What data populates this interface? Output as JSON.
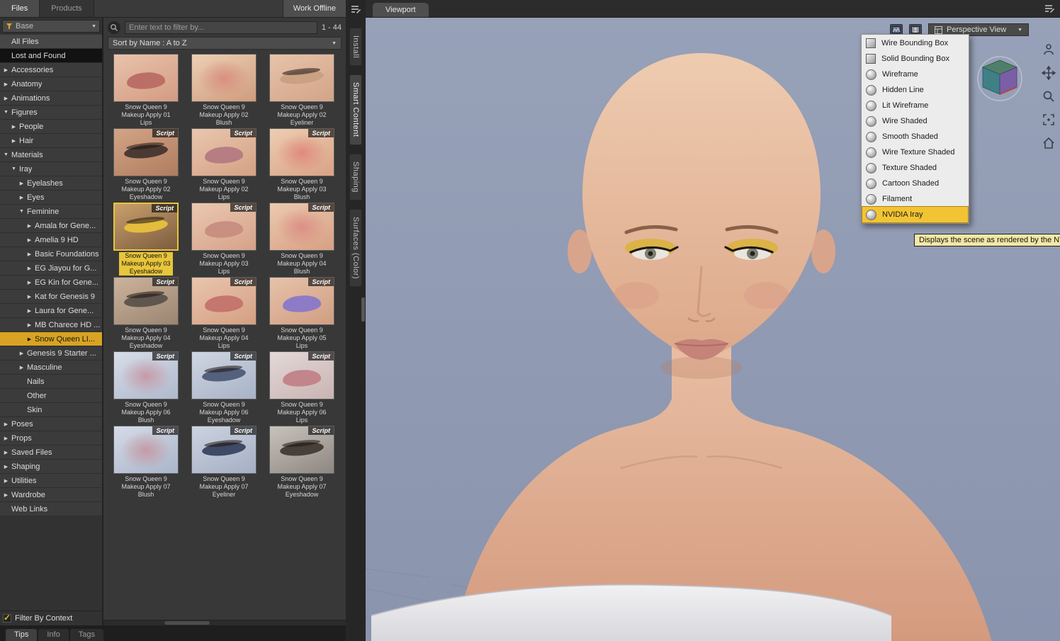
{
  "top_bar": {
    "tabs": [
      {
        "label": "Files"
      },
      {
        "label": "Products"
      }
    ],
    "work_offline_label": "Work Offline"
  },
  "filter_select": {
    "label": "Base"
  },
  "tree": {
    "filter_by_context": "Filter By Context",
    "items": [
      {
        "label": "All Files",
        "depth": 0,
        "arrow": "none",
        "style": "light"
      },
      {
        "label": "Lost and Found",
        "depth": 0,
        "arrow": "none",
        "style": "dark"
      },
      {
        "label": "Accessories",
        "depth": 0,
        "arrow": "right"
      },
      {
        "label": "Anatomy",
        "depth": 0,
        "arrow": "right"
      },
      {
        "label": "Animations",
        "depth": 0,
        "arrow": "right"
      },
      {
        "label": "Figures",
        "depth": 0,
        "arrow": "down"
      },
      {
        "label": "People",
        "depth": 1,
        "arrow": "right"
      },
      {
        "label": "Hair",
        "depth": 1,
        "arrow": "right"
      },
      {
        "label": "Materials",
        "depth": 0,
        "arrow": "down"
      },
      {
        "label": "Iray",
        "depth": 1,
        "arrow": "down"
      },
      {
        "label": "Eyelashes",
        "depth": 2,
        "arrow": "right"
      },
      {
        "label": "Eyes",
        "depth": 2,
        "arrow": "right"
      },
      {
        "label": "Feminine",
        "depth": 2,
        "arrow": "down"
      },
      {
        "label": "Amala for Gene...",
        "depth": 3,
        "arrow": "right"
      },
      {
        "label": "Amelia 9 HD",
        "depth": 3,
        "arrow": "right"
      },
      {
        "label": "Basic Foundations",
        "depth": 3,
        "arrow": "right"
      },
      {
        "label": "EG Jiayou for G...",
        "depth": 3,
        "arrow": "right"
      },
      {
        "label": "EG Kin for Gene...",
        "depth": 3,
        "arrow": "right"
      },
      {
        "label": "Kat for Genesis 9",
        "depth": 3,
        "arrow": "right"
      },
      {
        "label": "Laura for Gene...",
        "depth": 3,
        "arrow": "right"
      },
      {
        "label": "MB Charece HD ...",
        "depth": 3,
        "arrow": "right"
      },
      {
        "label": "Snow Queen LI...",
        "depth": 3,
        "arrow": "right",
        "selected": true
      },
      {
        "label": "Genesis 9 Starter ...",
        "depth": 2,
        "arrow": "right"
      },
      {
        "label": "Masculine",
        "depth": 2,
        "arrow": "right"
      },
      {
        "label": "Nails",
        "depth": 2,
        "arrow": "none"
      },
      {
        "label": "Other",
        "depth": 2,
        "arrow": "none"
      },
      {
        "label": "Skin",
        "depth": 2,
        "arrow": "none"
      },
      {
        "label": "Poses",
        "depth": 0,
        "arrow": "right"
      },
      {
        "label": "Props",
        "depth": 0,
        "arrow": "right"
      },
      {
        "label": "Saved Files",
        "depth": 0,
        "arrow": "right"
      },
      {
        "label": "Shaping",
        "depth": 0,
        "arrow": "right"
      },
      {
        "label": "Utilities",
        "depth": 0,
        "arrow": "right"
      },
      {
        "label": "Wardrobe",
        "depth": 0,
        "arrow": "right"
      },
      {
        "label": "Web Links",
        "depth": 0,
        "arrow": "none"
      }
    ]
  },
  "content": {
    "search_placeholder": "Enter text to filter by...",
    "count": "1 - 44",
    "sort_label": "Sort by Name : A to Z",
    "script_badge": "Script",
    "items": [
      {
        "label_lines": [
          "Snow Queen 9",
          "Makeup Apply 01",
          "Lips"
        ],
        "script": false,
        "thumb": {
          "kind": "lips",
          "bg1": "#e8c3ab",
          "bg2": "#d39b82",
          "accent": "#bc6f66"
        }
      },
      {
        "label_lines": [
          "Snow Queen 9",
          "Makeup Apply 02",
          "Blush"
        ],
        "script": false,
        "thumb": {
          "kind": "blush",
          "bg1": "#ecd0b4",
          "bg2": "#cf9c7e",
          "accent": "#d98f7f"
        }
      },
      {
        "label_lines": [
          "Snow Queen 9",
          "Makeup Apply 02",
          "Eyeliner"
        ],
        "script": false,
        "thumb": {
          "kind": "eye",
          "bg1": "#e7c3aa",
          "bg2": "#d2a488",
          "accent": "#caa183"
        }
      },
      {
        "label_lines": [
          "Snow Queen 9",
          "Makeup Apply 02",
          "Eyeshadow"
        ],
        "script": true,
        "thumb": {
          "kind": "eye",
          "bg1": "#d3a486",
          "bg2": "#b07c5f",
          "accent": "#4a3a33"
        }
      },
      {
        "label_lines": [
          "Snow Queen 9",
          "Makeup Apply 02",
          "Lips"
        ],
        "script": true,
        "thumb": {
          "kind": "lips",
          "bg1": "#e9c6ae",
          "bg2": "#d4a184",
          "accent": "#b67d83"
        }
      },
      {
        "label_lines": [
          "Snow Queen 9",
          "Makeup Apply 03",
          "Blush"
        ],
        "script": true,
        "thumb": {
          "kind": "blush",
          "bg1": "#edcdb2",
          "bg2": "#d9a285",
          "accent": "#e08a7c"
        }
      },
      {
        "label_lines": [
          "Snow Queen 9",
          "Makeup Apply 03",
          "Eyeshadow"
        ],
        "script": true,
        "selected": true,
        "thumb": {
          "kind": "eye",
          "bg1": "#c9a06c",
          "bg2": "#7c5c3e",
          "accent": "#e4bc3e"
        }
      },
      {
        "label_lines": [
          "Snow Queen 9",
          "Makeup Apply 03",
          "Lips"
        ],
        "script": true,
        "thumb": {
          "kind": "lips",
          "bg1": "#eac8b0",
          "bg2": "#d5a289",
          "accent": "#c98f80"
        }
      },
      {
        "label_lines": [
          "Snow Queen 9",
          "Makeup Apply 04",
          "Blush"
        ],
        "script": true,
        "thumb": {
          "kind": "blush",
          "bg1": "#ecc9ae",
          "bg2": "#d6a084",
          "accent": "#dc8f86"
        }
      },
      {
        "label_lines": [
          "Snow Queen 9",
          "Makeup Apply 04",
          "Eyeshadow"
        ],
        "script": true,
        "thumb": {
          "kind": "eye",
          "bg1": "#cdb39c",
          "bg2": "#9a8571",
          "accent": "#5f564e"
        }
      },
      {
        "label_lines": [
          "Snow Queen 9",
          "Makeup Apply 04",
          "Lips"
        ],
        "script": true,
        "thumb": {
          "kind": "lips",
          "bg1": "#e9c5ad",
          "bg2": "#d49f83",
          "accent": "#c4766f"
        }
      },
      {
        "label_lines": [
          "Snow Queen 9",
          "Makeup Apply 05",
          "Lips"
        ],
        "script": true,
        "thumb": {
          "kind": "lips",
          "bg1": "#e6c2aa",
          "bg2": "#d09e82",
          "accent": "#8d7bc7"
        }
      },
      {
        "label_lines": [
          "Snow Queen 9",
          "Makeup Apply 06",
          "Blush"
        ],
        "script": true,
        "thumb": {
          "kind": "face",
          "bg1": "#d7dde8",
          "bg2": "#aeb9cd",
          "accent": "#c79aa8"
        }
      },
      {
        "label_lines": [
          "Snow Queen 9",
          "Makeup Apply 06",
          "Eyeshadow"
        ],
        "script": true,
        "thumb": {
          "kind": "eye",
          "bg1": "#cfd6e2",
          "bg2": "#a8b2c6",
          "accent": "#53607e"
        }
      },
      {
        "label_lines": [
          "Snow Queen 9",
          "Makeup Apply 06",
          "Lips"
        ],
        "script": true,
        "thumb": {
          "kind": "lips",
          "bg1": "#e3d8d8",
          "bg2": "#c9b4b2",
          "accent": "#c2858b"
        }
      },
      {
        "label_lines": [
          "Snow Queen 9",
          "Makeup Apply 07",
          "Blush"
        ],
        "script": true,
        "thumb": {
          "kind": "face",
          "bg1": "#d5dbe7",
          "bg2": "#aab5ca",
          "accent": "#c59aa6"
        }
      },
      {
        "label_lines": [
          "Snow Queen 9",
          "Makeup Apply 07",
          "Eyeliner"
        ],
        "script": true,
        "thumb": {
          "kind": "eye",
          "bg1": "#ccd3e0",
          "bg2": "#a5afc4",
          "accent": "#3e4a66"
        }
      },
      {
        "label_lines": [
          "Snow Queen 9",
          "Makeup Apply 07",
          "Eyeshadow"
        ],
        "script": true,
        "thumb": {
          "kind": "eye",
          "bg1": "#c8c2bc",
          "bg2": "#8e8781",
          "accent": "#474039"
        }
      }
    ]
  },
  "side_tabs": [
    "Install",
    "Smart Content",
    "Shaping",
    "Surfaces (Color)"
  ],
  "bottom_tabs": [
    "Tips",
    "Info",
    "Tags"
  ],
  "viewport": {
    "tab": "Viewport",
    "view_selector": {
      "label": "Perspective View"
    },
    "draw_style_menu": {
      "items": [
        {
          "label": "Wire Bounding Box",
          "icon": "wire-cube"
        },
        {
          "label": "Solid Bounding Box",
          "icon": "solid-cube"
        },
        {
          "label": "Wireframe",
          "icon": "sphere"
        },
        {
          "label": "Hidden Line",
          "icon": "sphere"
        },
        {
          "label": "Lit Wireframe",
          "icon": "sphere"
        },
        {
          "label": "Wire Shaded",
          "icon": "sphere"
        },
        {
          "label": "Smooth Shaded",
          "icon": "sphere"
        },
        {
          "label": "Wire Texture Shaded",
          "icon": "sphere"
        },
        {
          "label": "Texture Shaded",
          "icon": "sphere"
        },
        {
          "label": "Cartoon Shaded",
          "icon": "sphere"
        },
        {
          "label": "Filament",
          "icon": "sphere"
        },
        {
          "label": "NVIDIA Iray",
          "icon": "sphere",
          "highlighted": true
        }
      ]
    },
    "tooltip": "Displays the scene as rendered by the NV"
  },
  "colors": {
    "accent_gold": "#d8a322",
    "selection_yellow": "#e8c53a",
    "viewport_background": "#8e99b2",
    "menu_highlight": "#f2c434"
  }
}
